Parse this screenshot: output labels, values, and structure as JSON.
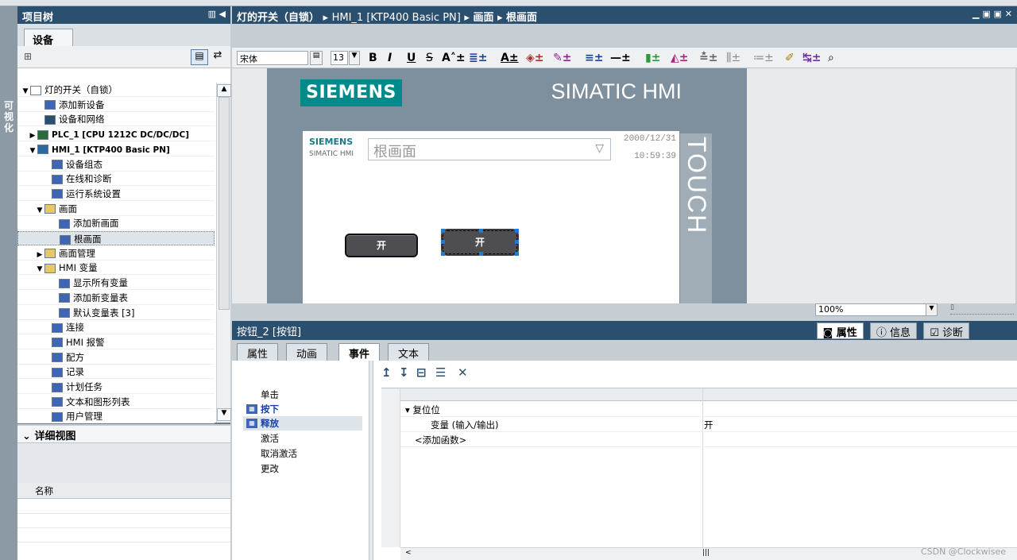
{
  "sidebar_vertical_label": "可视化",
  "project_tree": {
    "title": "项目树",
    "tab_devices": "设备",
    "items": [
      {
        "label": "灯的开关（自锁）",
        "icon": "project-icon"
      },
      {
        "label": "添加新设备",
        "icon": "add-device-icon"
      },
      {
        "label": "设备和网络",
        "icon": "network-icon"
      },
      {
        "label": "PLC_1 [CPU 1212C DC/DC/DC]",
        "icon": "plc-icon"
      },
      {
        "label": "HMI_1 [KTP400 Basic PN]",
        "icon": "hmi-icon"
      },
      {
        "label": "设备组态",
        "icon": "device-config-icon"
      },
      {
        "label": "在线和诊断",
        "icon": "online-diag-icon"
      },
      {
        "label": "运行系统设置",
        "icon": "runtime-settings-icon"
      },
      {
        "label": "画面",
        "icon": "folder-icon"
      },
      {
        "label": "添加新画面",
        "icon": "add-screen-icon"
      },
      {
        "label": "根画面",
        "icon": "screen-icon"
      },
      {
        "label": "画面管理",
        "icon": "folder-icon"
      },
      {
        "label": "HMI 变量",
        "icon": "folder-icon"
      },
      {
        "label": "显示所有变量",
        "icon": "show-tags-icon"
      },
      {
        "label": "添加新变量表",
        "icon": "add-tagtable-icon"
      },
      {
        "label": "默认变量表 [3]",
        "icon": "tagtable-icon"
      },
      {
        "label": "连接",
        "icon": "connection-icon"
      },
      {
        "label": "HMI 报警",
        "icon": "alarm-icon"
      },
      {
        "label": "配方",
        "icon": "recipe-icon"
      },
      {
        "label": "记录",
        "icon": "log-icon"
      },
      {
        "label": "计划任务",
        "icon": "scheduler-icon"
      },
      {
        "label": "文本和图形列表",
        "icon": "textlist-icon"
      },
      {
        "label": "用户管理",
        "icon": "users-icon"
      }
    ]
  },
  "detail_view": {
    "title": "详细视图",
    "column_name": "名称"
  },
  "editor": {
    "breadcrumb": [
      "灯的开关（自锁）",
      "HMI_1 [KTP400 Basic PN]",
      "画面",
      "根画面"
    ],
    "font_name": "宋体",
    "font_size": "13",
    "zoom": "100%"
  },
  "hmi": {
    "brand": "SIEMENS",
    "product": "SIMATIC HMI",
    "touch": "TOUCH",
    "screen_brand": "SIEMENS",
    "screen_product": "SIMATIC HMI",
    "screen_dropdown": "根画面",
    "date": "2000/12/31",
    "time": "10:59:39",
    "button1": "开",
    "button2": "开"
  },
  "properties": {
    "title": "按钮_2 [按钮]",
    "right_tabs": [
      "属性",
      "信息",
      "诊断"
    ],
    "tabs": [
      "属性",
      "动画",
      "事件",
      "文本"
    ],
    "active_tab": "事件",
    "events": [
      "单击",
      "按下",
      "释放",
      "激活",
      "取消激活",
      "更改"
    ],
    "active_events": [
      "按下",
      "释放"
    ],
    "grid_rows": [
      {
        "name": "复位位",
        "value": ""
      },
      {
        "name": "变量 (输入/输出)",
        "value": "开"
      },
      {
        "name": "<添加函数>",
        "value": ""
      }
    ]
  },
  "watermark": "CSDN @Clockwisee"
}
